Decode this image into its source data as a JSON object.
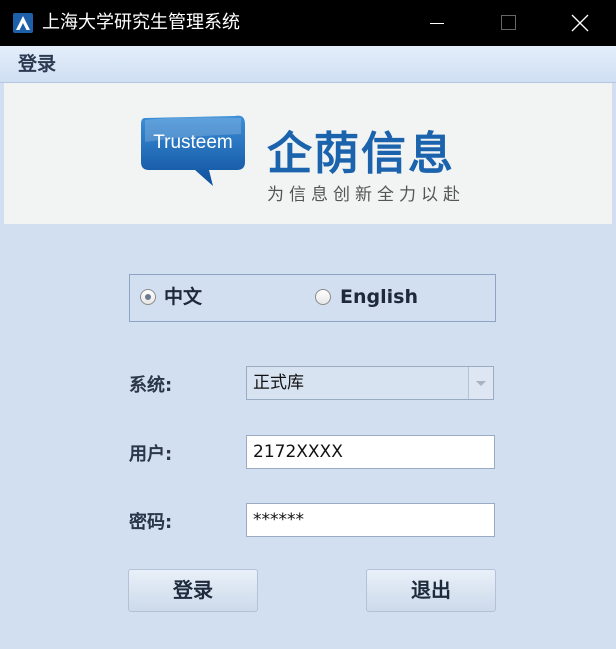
{
  "window": {
    "title": "上海大学研究生管理系统",
    "icon": "app-logo-icon"
  },
  "menu": {
    "login": "登录"
  },
  "banner": {
    "logo_text": "Trusteem",
    "company_name": "企荫信息",
    "slogan": "为信息创新全力以赴",
    "brand_color": "#1b63ad"
  },
  "language": {
    "options": [
      {
        "label": "中文",
        "checked": true
      },
      {
        "label": "English",
        "checked": false
      }
    ]
  },
  "form": {
    "system_label": "系统:",
    "system_value": "正式库",
    "user_label": "用户:",
    "user_value": "2172XXXX",
    "password_label": "密码:",
    "password_value": "******"
  },
  "buttons": {
    "login": "登录",
    "exit": "退出"
  },
  "colors": {
    "background": "#d2dff0",
    "titlebar": "#000000"
  }
}
